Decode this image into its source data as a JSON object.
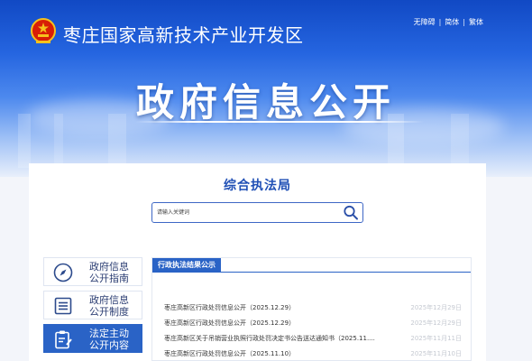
{
  "header": {
    "site_name": "枣庄国家高新技术产业开发区",
    "links": [
      "无障碍",
      "简体",
      "繁体"
    ],
    "hero_title": "政府信息公开"
  },
  "department": {
    "title": "综合执法局"
  },
  "search": {
    "placeholder": "请输入关键词"
  },
  "sidebar": {
    "items": [
      {
        "line1": "政府信息",
        "line2": "公开指南",
        "icon": "compass-icon",
        "active": false
      },
      {
        "line1": "政府信息",
        "line2": "公开制度",
        "icon": "document-list-icon",
        "active": false
      },
      {
        "line1": "法定主动",
        "line2": "公开内容",
        "icon": "clipboard-edit-icon",
        "active": true
      }
    ]
  },
  "content": {
    "tab": "行政执法结果公示",
    "rows": [
      {
        "title": "枣庄高新区行政处罚信息公开（2025.12.29）",
        "date": "2025年12月29日"
      },
      {
        "title": "枣庄高新区行政处罚信息公开（2025.12.29）",
        "date": "2025年12月29日"
      },
      {
        "title": "枣庄高新区关于吊销营业执照行政处罚决定书公告送达通知书（2025.11....",
        "date": "2025年11月11日"
      },
      {
        "title": "枣庄高新区行政处罚信息公开（2025.11.10）",
        "date": "2025年11月10日"
      }
    ]
  },
  "colors": {
    "primary_blue": "#2a63c6",
    "title_blue": "#1f4fb5",
    "date_gray": "#c5c9d1"
  }
}
